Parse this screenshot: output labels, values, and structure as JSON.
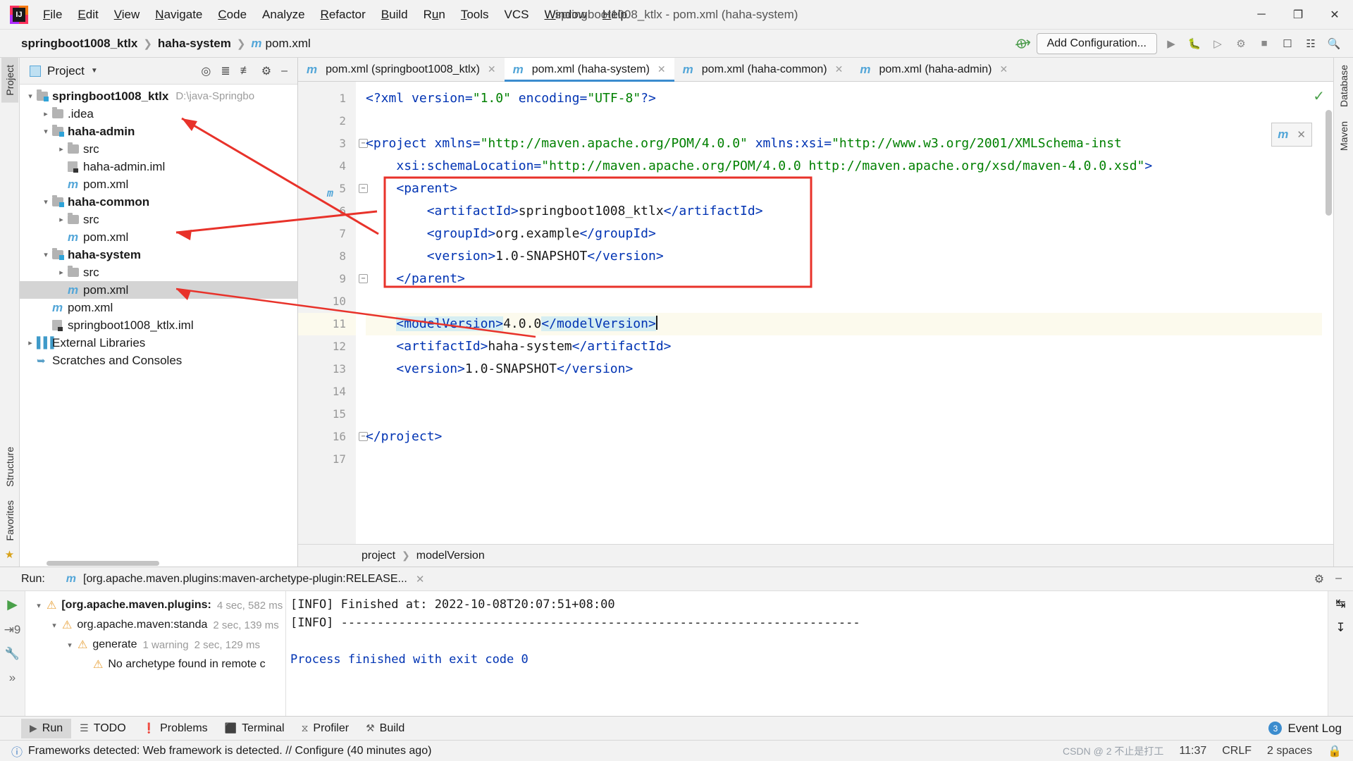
{
  "window": {
    "title": "springboot1008_ktlx - pom.xml (haha-system)",
    "logo_letter": "IJ",
    "controls": {
      "minimize": "─",
      "maximize": "❐",
      "close": "✕"
    }
  },
  "menubar": [
    {
      "label": "File",
      "mnemonic": "F"
    },
    {
      "label": "Edit",
      "mnemonic": "E"
    },
    {
      "label": "View",
      "mnemonic": "V"
    },
    {
      "label": "Navigate",
      "mnemonic": "N"
    },
    {
      "label": "Code",
      "mnemonic": "C"
    },
    {
      "label": "Analyze",
      "mnemonic": ""
    },
    {
      "label": "Refactor",
      "mnemonic": "R"
    },
    {
      "label": "Build",
      "mnemonic": "B"
    },
    {
      "label": "Run",
      "mnemonic": "u"
    },
    {
      "label": "Tools",
      "mnemonic": "T"
    },
    {
      "label": "VCS",
      "mnemonic": ""
    },
    {
      "label": "Window",
      "mnemonic": "W"
    },
    {
      "label": "Help",
      "mnemonic": "H"
    }
  ],
  "navbar": {
    "crumbs": [
      "springboot1008_ktlx",
      "haha-system",
      "pom.xml"
    ],
    "file_icon": "maven-m-icon",
    "add_configuration_label": "Add Configuration...",
    "hammer_icon": "build-hammer-icon",
    "icons": [
      "run-icon",
      "debug-icon",
      "run-with-coverage-icon",
      "profile-icon",
      "stop-icon",
      "device-manager-icon",
      "avd-icon",
      "search-icon"
    ]
  },
  "left_rail": {
    "top_tab": "Project",
    "bottom_tabs": [
      "Structure",
      "Favorites"
    ]
  },
  "right_rail": {
    "tabs": [
      "Database",
      "Maven"
    ]
  },
  "project_window": {
    "title": "Project",
    "toolbar_icons": [
      "locate-icon",
      "expand-all-icon",
      "collapse-all-icon",
      "settings-gear-icon",
      "hide-icon"
    ],
    "tree": [
      {
        "depth": 0,
        "arrow": "down",
        "icon": "module-folder-icon",
        "label": "springboot1008_ktlx",
        "bold": true,
        "path": "D:\\java-Springbo",
        "selected": false
      },
      {
        "depth": 1,
        "arrow": "right",
        "icon": "folder-icon",
        "label": ".idea",
        "bold": false,
        "path": "",
        "selected": false
      },
      {
        "depth": 1,
        "arrow": "down",
        "icon": "module-folder-icon",
        "label": "haha-admin",
        "bold": true,
        "path": "",
        "selected": false
      },
      {
        "depth": 2,
        "arrow": "right",
        "icon": "folder-icon",
        "label": "src",
        "bold": false,
        "path": "",
        "selected": false
      },
      {
        "depth": 2,
        "arrow": "none",
        "icon": "iml-file-icon",
        "label": "haha-admin.iml",
        "bold": false,
        "path": "",
        "selected": false
      },
      {
        "depth": 2,
        "arrow": "none",
        "icon": "maven-m-icon",
        "label": "pom.xml",
        "bold": false,
        "path": "",
        "selected": false
      },
      {
        "depth": 1,
        "arrow": "down",
        "icon": "module-folder-icon",
        "label": "haha-common",
        "bold": true,
        "path": "",
        "selected": false
      },
      {
        "depth": 2,
        "arrow": "right",
        "icon": "folder-icon",
        "label": "src",
        "bold": false,
        "path": "",
        "selected": false
      },
      {
        "depth": 2,
        "arrow": "none",
        "icon": "maven-m-icon",
        "label": "pom.xml",
        "bold": false,
        "path": "",
        "selected": false
      },
      {
        "depth": 1,
        "arrow": "down",
        "icon": "module-folder-icon",
        "label": "haha-system",
        "bold": true,
        "path": "",
        "selected": false
      },
      {
        "depth": 2,
        "arrow": "right",
        "icon": "folder-icon",
        "label": "src",
        "bold": false,
        "path": "",
        "selected": false
      },
      {
        "depth": 2,
        "arrow": "none",
        "icon": "maven-m-icon",
        "label": "pom.xml",
        "bold": false,
        "path": "",
        "selected": true
      },
      {
        "depth": 1,
        "arrow": "none",
        "icon": "maven-m-icon",
        "label": "pom.xml",
        "bold": false,
        "path": "",
        "selected": false
      },
      {
        "depth": 1,
        "arrow": "none",
        "icon": "iml-file-icon",
        "label": "springboot1008_ktlx.iml",
        "bold": false,
        "path": "",
        "selected": false
      },
      {
        "depth": 0,
        "arrow": "right",
        "icon": "external-libraries-icon",
        "label": "External Libraries",
        "bold": false,
        "path": "",
        "selected": false
      },
      {
        "depth": 0,
        "arrow": "none",
        "icon": "scratches-icon",
        "label": "Scratches and Consoles",
        "bold": false,
        "path": "",
        "selected": false
      }
    ]
  },
  "editor": {
    "tabs": [
      {
        "label": "pom.xml (springboot1008_ktlx)",
        "active": false
      },
      {
        "label": "pom.xml (haha-system)",
        "active": true
      },
      {
        "label": "pom.xml (haha-common)",
        "active": false
      },
      {
        "label": "pom.xml (haha-admin)",
        "active": false
      }
    ],
    "current_line": 11,
    "inspection_status": "ok-check-icon",
    "lines": [
      {
        "n": 1,
        "fold": false,
        "html": "<span class=\"tg\">&lt;?xml</span> <span class=\"at\">version=</span><span class=\"av\">\"1.0\"</span> <span class=\"at\">encoding=</span><span class=\"av\">\"UTF-8\"</span><span class=\"tg\">?&gt;</span>"
      },
      {
        "n": 2,
        "fold": false,
        "html": ""
      },
      {
        "n": 3,
        "fold": true,
        "html": "<span class=\"tg\">&lt;project</span> <span class=\"at\">xmlns=</span><span class=\"av\">\"http://maven.apache.org/POM/4.0.0\"</span> <span class=\"at\">xmlns:xsi=</span><span class=\"av\">\"http://www.w3.org/2001/XMLSchema-inst</span>"
      },
      {
        "n": 4,
        "fold": false,
        "html": "    <span class=\"at\">xsi:schemaLocation=</span><span class=\"av\">\"http://maven.apache.org/POM/4.0.0 http://maven.apache.org/xsd/maven-4.0.0.xsd\"</span><span class=\"tg\">&gt;</span>"
      },
      {
        "n": 5,
        "fold": true,
        "html": "    <span class=\"tg\">&lt;parent&gt;</span>"
      },
      {
        "n": 6,
        "fold": false,
        "html": "        <span class=\"tg\">&lt;artifactId&gt;</span><span class=\"txt\">springboot1008_ktlx</span><span class=\"tg\">&lt;/artifactId&gt;</span>"
      },
      {
        "n": 7,
        "fold": false,
        "html": "        <span class=\"tg\">&lt;groupId&gt;</span><span class=\"txt\">org.example</span><span class=\"tg\">&lt;/groupId&gt;</span>"
      },
      {
        "n": 8,
        "fold": false,
        "html": "        <span class=\"tg\">&lt;version&gt;</span><span class=\"txt\">1.0-SNAPSHOT</span><span class=\"tg\">&lt;/version&gt;</span>"
      },
      {
        "n": 9,
        "fold": true,
        "html": "    <span class=\"tg\">&lt;/parent&gt;</span>"
      },
      {
        "n": 10,
        "fold": false,
        "html": ""
      },
      {
        "n": 11,
        "fold": false,
        "html": "    <span class=\"tg hl\">&lt;modelVersion&gt;</span><span class=\"txt\">4.0.0</span><span class=\"tg hl\">&lt;/modelVersion&gt;</span><span class=\"caret-bar\"></span>"
      },
      {
        "n": 12,
        "fold": false,
        "html": "    <span class=\"tg\">&lt;artifactId&gt;</span><span class=\"txt\">haha-system</span><span class=\"tg\">&lt;/artifactId&gt;</span>"
      },
      {
        "n": 13,
        "fold": false,
        "html": "    <span class=\"tg\">&lt;version&gt;</span><span class=\"txt\">1.0-SNAPSHOT</span><span class=\"tg\">&lt;/version&gt;</span>"
      },
      {
        "n": 14,
        "fold": false,
        "html": ""
      },
      {
        "n": 15,
        "fold": false,
        "html": ""
      },
      {
        "n": 16,
        "fold": true,
        "html": "<span class=\"tg\">&lt;/project&gt;</span>"
      },
      {
        "n": 17,
        "fold": false,
        "html": ""
      }
    ],
    "breadcrumbs": [
      "project",
      "modelVersion"
    ],
    "maven_popup": {
      "icon": "maven-reimport-icon",
      "close": "✕"
    }
  },
  "run_panel": {
    "label": "Run:",
    "config_name": "[org.apache.maven.plugins:maven-archetype-plugin:RELEASE...",
    "close": "✕",
    "action_icons": [
      "rerun-icon",
      "rerun-failed-icon",
      "settings-wrench-icon",
      "more-icon"
    ],
    "right_icons": [
      "wrap-text-icon",
      "scroll-to-end-icon"
    ],
    "header_right_icons": [
      "gear-icon",
      "hide-icon"
    ],
    "tree": [
      {
        "depth": 0,
        "arrow": "down",
        "label": "[org.apache.maven.plugins:",
        "bold": true,
        "time": "4 sec, 582 ms",
        "extra": ""
      },
      {
        "depth": 1,
        "arrow": "down",
        "label": "org.apache.maven:standa",
        "bold": false,
        "time": "2 sec, 139 ms",
        "extra": ""
      },
      {
        "depth": 2,
        "arrow": "down",
        "label": "generate",
        "bold": false,
        "time": "2 sec, 129 ms",
        "extra": "1 warning"
      },
      {
        "depth": 3,
        "arrow": "none",
        "label": "No archetype found in remote c",
        "bold": false,
        "time": "",
        "extra": ""
      }
    ],
    "console": [
      "[INFO] Finished at: 2022-10-08T20:07:51+08:00",
      "[INFO] ------------------------------------------------------------------------",
      "",
      "Process finished with exit code 0"
    ]
  },
  "tool_strip": {
    "items": [
      {
        "label": "Run",
        "icon": "run-play-icon",
        "selected": true
      },
      {
        "label": "TODO",
        "icon": "todo-list-icon",
        "selected": false
      },
      {
        "label": "Problems",
        "icon": "problems-icon",
        "selected": false
      },
      {
        "label": "Terminal",
        "icon": "terminal-icon",
        "selected": false
      },
      {
        "label": "Profiler",
        "icon": "profiler-icon",
        "selected": false
      },
      {
        "label": "Build",
        "icon": "build-hammer-icon",
        "selected": false
      }
    ],
    "event_log": {
      "label": "Event Log",
      "count": "3"
    }
  },
  "status_bar": {
    "message": "Frameworks detected: Web framework is detected. // Configure (40 minutes ago)",
    "time": "11:37",
    "line_separator": "CRLF",
    "indent": "2 spaces",
    "watermark": "CSDN @ 2 不止是打工"
  },
  "colors": {
    "accent_blue": "#3b8cce",
    "maven_blue": "#53a6d8",
    "tag_blue": "#0033b3",
    "attr_green": "#008000",
    "warn_orange": "#e8a33d",
    "annotation_red": "#e8322a",
    "selection_highlight": "#d6eef2"
  }
}
